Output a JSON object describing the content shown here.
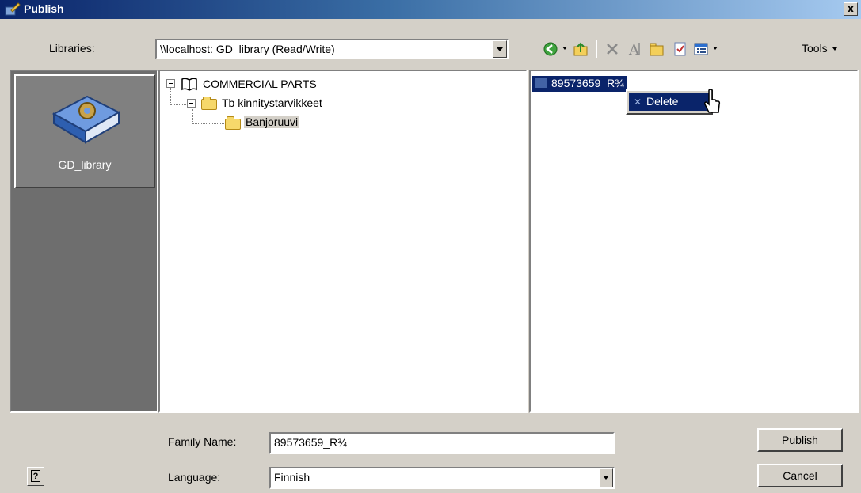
{
  "window": {
    "title": "Publish",
    "close_label": "x"
  },
  "toolbar_top": {
    "libraries_label": "Libraries:",
    "library_value": "\\\\localhost: GD_library (Read/Write)",
    "tools_label": "Tools"
  },
  "icons": [
    "publish-icon",
    "back-icon",
    "up-folder-icon",
    "delete-icon",
    "rename-icon",
    "new-folder-icon",
    "properties-icon",
    "view-icon",
    "help-icon"
  ],
  "libraries": [
    {
      "label": "GD_library"
    }
  ],
  "tree": [
    {
      "label": "COMMERCIAL PARTS"
    },
    {
      "label": "Tb kinnitystarvikkeet"
    },
    {
      "label": "Banjoruuvi"
    }
  ],
  "files": [
    {
      "label": "89573659_R¾"
    }
  ],
  "context_menu": {
    "items": [
      {
        "label": "Delete"
      }
    ]
  },
  "form": {
    "family_name_label": "Family Name:",
    "family_name_value": "89573659_R¾",
    "language_label": "Language:",
    "language_value": "Finnish"
  },
  "buttons": {
    "publish": "Publish",
    "cancel": "Cancel",
    "help": "?"
  },
  "colors": {
    "title_start": "#0a246a",
    "selection": "#0a246a",
    "face": "#d4d0c8"
  }
}
